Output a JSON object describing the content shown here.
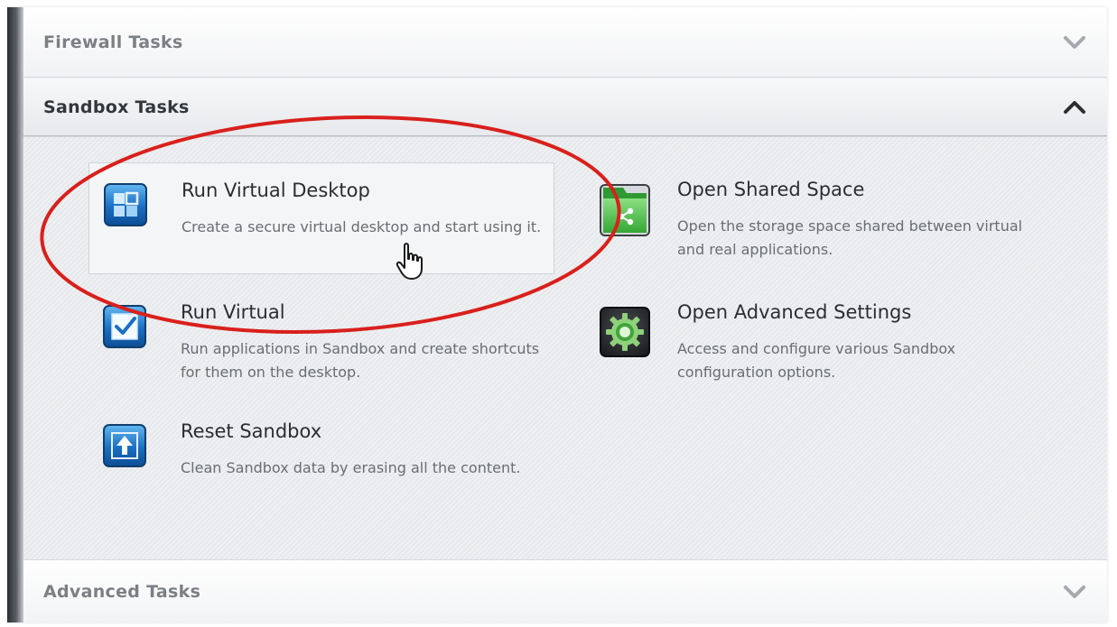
{
  "sections": {
    "firewall": {
      "title": "Firewall Tasks",
      "state": "collapsed"
    },
    "sandbox": {
      "title": "Sandbox Tasks",
      "state": "expanded"
    },
    "advanced": {
      "title": "Advanced Tasks",
      "state": "collapsed"
    }
  },
  "tasks": [
    {
      "title": "Run Virtual Desktop",
      "description": "Create a secure virtual desktop and start using it.",
      "icon": "virtual-desktop-icon"
    },
    {
      "title": "Open Shared Space",
      "description": "Open the storage space shared between virtual and real applications.",
      "icon": "shared-folder-icon"
    },
    {
      "title": "Run Virtual",
      "description": "Run applications in Sandbox and create shortcuts for them on the desktop.",
      "icon": "checkbox-icon"
    },
    {
      "title": "Open Advanced Settings",
      "description": "Access and configure various Sandbox configuration options.",
      "icon": "gear-icon"
    },
    {
      "title": "Reset Sandbox",
      "description": "Clean Sandbox data by erasing all the content.",
      "icon": "reset-arrow-icon"
    }
  ],
  "colors": {
    "annotation": "#d9201c",
    "icon_blue": "#1a6fc4",
    "icon_green": "#3bb43a"
  }
}
